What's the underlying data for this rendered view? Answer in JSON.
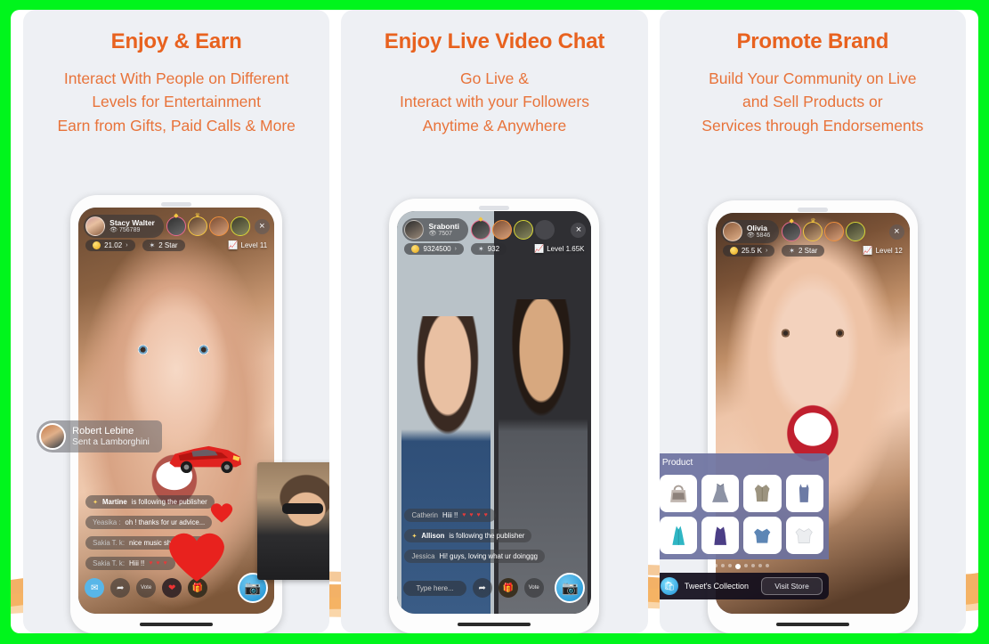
{
  "frame": {
    "border_color": "#00f51c",
    "canvas_color": "#ffffff",
    "card_color": "#eef0f4",
    "accent_color": "#e8621f",
    "subtext_color": "#e8733a"
  },
  "panels": [
    {
      "title": "Enjoy & Earn",
      "subtitle": "Interact With People on Different\nLevels for Entertainment\nEarn from Gifts, Paid Calls & More",
      "live": {
        "host_name": "Stacy Walter",
        "followers": "756789",
        "coins": "21.02",
        "stars": "2 Star",
        "level": "Level 11",
        "close_label": "×"
      },
      "gift_toast": {
        "name": "Robert Lebine",
        "desc": "Sent a Lamborghini"
      },
      "chat": [
        {
          "who": "Martine",
          "text": "is following the publisher",
          "type": "follow"
        },
        {
          "who": "Yeasika :",
          "text": "oh ! thanks for ur advice...",
          "type": "msg"
        },
        {
          "who": "Sakia T. k:",
          "text": "nice music show last night",
          "type": "msg"
        },
        {
          "who": "Sakia T. k:",
          "text": "Hiii !!",
          "type": "msg",
          "hearts": "♥ ♥ ♥"
        }
      ],
      "bottombar": {
        "icons": [
          "message-icon",
          "share-icon",
          "vote-icon",
          "heart-icon",
          "gift-icon"
        ],
        "vote_label": "Vote",
        "call_icon": "video-call-icon"
      }
    },
    {
      "title": "Enjoy Live Video Chat",
      "subtitle": "Go Live &\nInteract with your Followers\nAnytime & Anywhere",
      "live": {
        "host_name": "Srabonti",
        "followers": "7507",
        "coins": "9324500",
        "stars": "932",
        "level": "Level 1.65K",
        "close_label": "×"
      },
      "chat": [
        {
          "who": "Catherin",
          "text": "Hiii !!",
          "type": "msg",
          "hearts": "♥ ♥ ♥ ♥"
        },
        {
          "who": "Allison",
          "text": "is following the publisher",
          "type": "follow"
        },
        {
          "who": "Jessica",
          "text": "Hi! guys, loving what ur doinggg",
          "type": "msg"
        }
      ],
      "bottombar": {
        "input_placeholder": "Type here...",
        "icons": [
          "share-icon",
          "gift-icon",
          "vote-icon"
        ],
        "vote_label": "Vote",
        "call_icon": "video-call-icon"
      }
    },
    {
      "title": "Promote Brand",
      "subtitle": "Build Your Community on Live\nand Sell Products or\nServices  through  Endorsements",
      "live": {
        "host_name": "Olivia",
        "followers": "5846",
        "coins": "25.5 K",
        "stars": "2 Star",
        "level": "Level 12",
        "close_label": "×"
      },
      "product": {
        "header": "Product",
        "items": [
          {
            "name": "handbag",
            "color": "#b9b2ae"
          },
          {
            "name": "grey-flare-dress",
            "color": "#8d93a5"
          },
          {
            "name": "khaki-shirt-dress",
            "color": "#9c9480"
          },
          {
            "name": "blue-slip-dress",
            "color": "#6c7ba5"
          },
          {
            "name": "teal-gown",
            "color": "#2fb6c4"
          },
          {
            "name": "purple-dress",
            "color": "#4b3e86"
          },
          {
            "name": "blue-top",
            "color": "#5d86b5"
          },
          {
            "name": "white-tee",
            "color": "#e8eaed"
          }
        ],
        "page_dots": 8,
        "active_dot": 4,
        "store_name": "Tweet's Collection",
        "store_button": "Visit Store"
      }
    }
  ]
}
